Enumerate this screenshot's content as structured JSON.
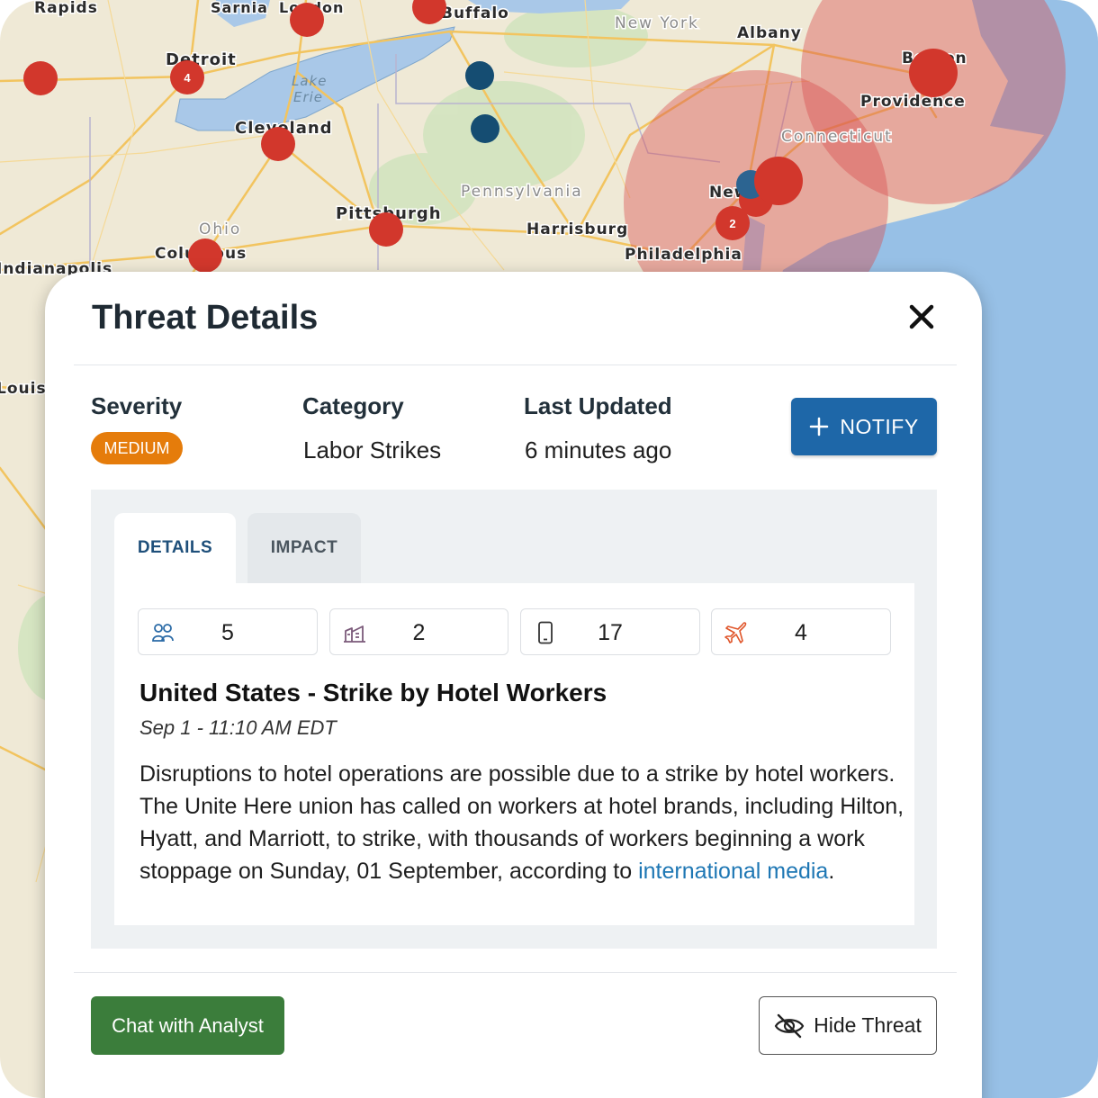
{
  "map": {
    "colors": {
      "land": "#efe9d6",
      "water": "#a9c8e8",
      "ocean": "#97c0e6",
      "road": "#f2c45f",
      "high_threat": "#d2372c",
      "low_threat": "#154d72",
      "radius_fill": "#d94f4f"
    },
    "cities": [
      {
        "label": "Rapids"
      },
      {
        "label": "Sarnia"
      },
      {
        "label": "London"
      },
      {
        "label": "Buffalo"
      },
      {
        "label": "Albany"
      },
      {
        "label": "Detroit"
      },
      {
        "label": "Cleveland"
      },
      {
        "label": "Boston"
      },
      {
        "label": "Providence"
      },
      {
        "label": "Pittsburgh"
      },
      {
        "label": "Harrisburg"
      },
      {
        "label": "Philadelphia"
      },
      {
        "label": "Columbus"
      },
      {
        "label": "Indianapolis"
      },
      {
        "label": "Louisville"
      },
      {
        "label": "New"
      }
    ],
    "states": [
      {
        "label": "New York"
      },
      {
        "label": "Pennsylvania"
      },
      {
        "label": "Ohio"
      },
      {
        "label": "Connecticut"
      }
    ],
    "lakes": [
      {
        "label": "Lake"
      },
      {
        "label": "Erie"
      }
    ],
    "cluster_counts": [
      "4",
      "2"
    ]
  },
  "panel": {
    "title": "Threat Details",
    "close_icon": "close-icon",
    "severity": {
      "label": "Severity",
      "value": "MEDIUM",
      "color": "#e57c0b"
    },
    "category": {
      "label": "Category",
      "value": "Labor Strikes"
    },
    "last_updated": {
      "label": "Last Updated",
      "value": "6 minutes ago"
    },
    "notify_label": "NOTIFY",
    "tabs": [
      {
        "label": "DETAILS",
        "active": true
      },
      {
        "label": "IMPACT",
        "active": false
      }
    ],
    "stats": [
      {
        "icon": "people-icon",
        "value": "5"
      },
      {
        "icon": "hotel-icon",
        "value": "2"
      },
      {
        "icon": "mobile-icon",
        "value": "17"
      },
      {
        "icon": "airplane-icon",
        "value": "4"
      }
    ],
    "headline": "United States - Strike by Hotel Workers",
    "timestamp": "Sep 1 - 11:10 AM EDT",
    "description": "Disruptions to hotel operations are possible due to a strike by hotel workers. The Unite Here union has called on workers at hotel brands, including Hilton, Hyatt, and Marriott, to strike, with thousands of workers beginning a work stoppage on Sunday, 01 September, according to ",
    "description_link": "international media",
    "description_end": ".",
    "chat_button": "Chat with Analyst",
    "hide_button": "Hide Threat"
  }
}
